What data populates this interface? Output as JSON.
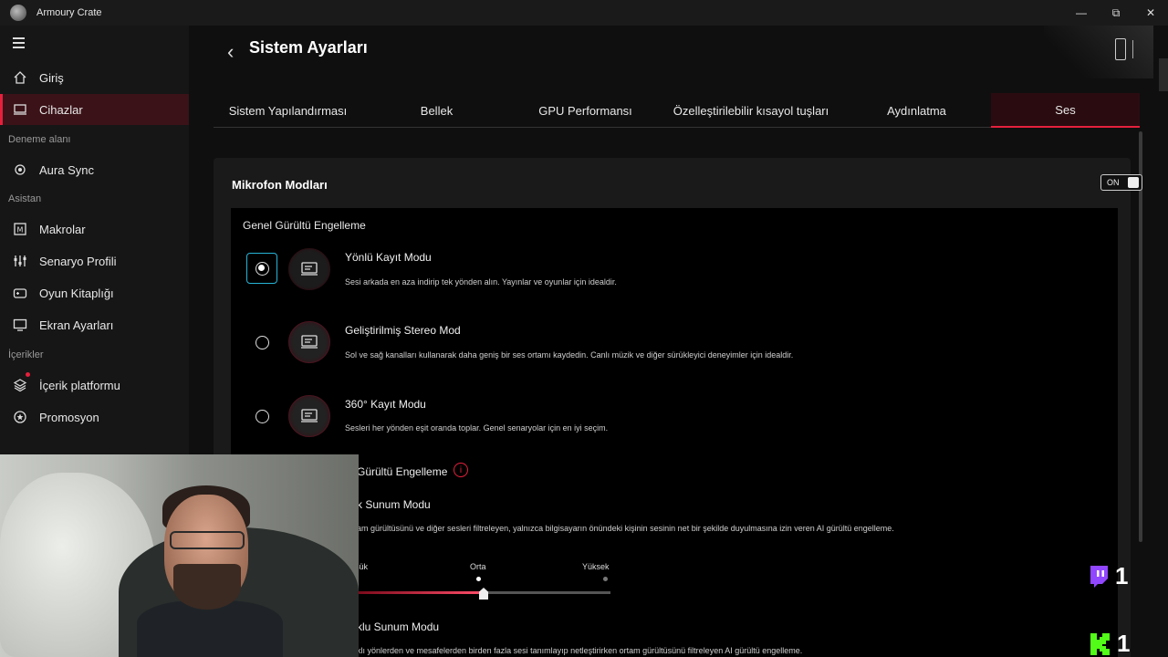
{
  "app": {
    "title": "Armoury Crate"
  },
  "window_controls": {
    "minimize": "—",
    "maximize": "⧉",
    "close": "✕"
  },
  "sidebar": {
    "items": [
      {
        "label": "Giriş",
        "icon": "home-icon"
      },
      {
        "label": "Cihazlar",
        "icon": "laptop-icon",
        "active": true
      },
      {
        "label": "Aura Sync",
        "icon": "aura-icon"
      },
      {
        "label": "Makrolar",
        "icon": "macro-icon"
      },
      {
        "label": "Senaryo Profili",
        "icon": "scenario-icon"
      },
      {
        "label": "Oyun Kitaplığı",
        "icon": "gamepad-icon"
      },
      {
        "label": "Ekran Ayarları",
        "icon": "monitor-icon"
      },
      {
        "label": "İçerik platformu",
        "icon": "layers-icon"
      },
      {
        "label": "Promosyon",
        "icon": "badge-icon"
      }
    ],
    "sections": [
      "Deneme alanı",
      "Asistan",
      "İçerikler"
    ]
  },
  "main": {
    "title": "Sistem Ayarları",
    "tabs": [
      {
        "label": "Sistem Yapılandırması"
      },
      {
        "label": "Bellek"
      },
      {
        "label": "GPU Performansı"
      },
      {
        "label": "Özelleştirilebilir kısayol tuşları"
      },
      {
        "label": "Aydınlatma"
      },
      {
        "label": "Ses",
        "active": true
      }
    ]
  },
  "mic": {
    "title": "Mikrofon Modları",
    "toggle": "ON",
    "general_title": "Genel Gürültü Engelleme",
    "modes": [
      {
        "name": "Yönlü Kayıt Modu",
        "desc": "Sesi arkada en aza indirip tek yönden alın. Yayınlar ve oyunlar için idealdir.",
        "selected": true
      },
      {
        "name": "Geliştirilmiş Stereo Mod",
        "desc": "Sol ve sağ kanalları kullanarak daha geniş bir ses ortamı kaydedin. Canlı müzik ve diğer sürükleyici deneyimler için idealdir.",
        "selected": false
      },
      {
        "name": "360° Kayıt Modu",
        "desc": "Sesleri her yönden eşit oranda toplar. Genel senaryolar için en iyi seçim.",
        "selected": false
      }
    ],
    "ai_title": "Gürültü Engelleme",
    "ai_modes": [
      {
        "name": "k Sunum Modu",
        "desc": "am gürültüsünü ve diğer sesleri filtreleyen, yalnızca bilgisayarın önündeki kişinin sesinin net bir şekilde duyulmasına izin veren AI gürültü engelleme."
      },
      {
        "name": "klu Sunum Modu",
        "desc": "klı yönlerden ve mesafelerden birden fazla sesi tanımlayıp netleştirirken ortam gürültüsünü filtreleyen AI gürültü engelleme."
      }
    ],
    "levels": [
      "şük",
      "Orta",
      "Yüksek"
    ],
    "level_value": 0.5
  },
  "badges": {
    "twitch_count": "1",
    "kick_count": "1"
  },
  "colors": {
    "accent": "#e5203c",
    "select": "#27b4d6"
  }
}
